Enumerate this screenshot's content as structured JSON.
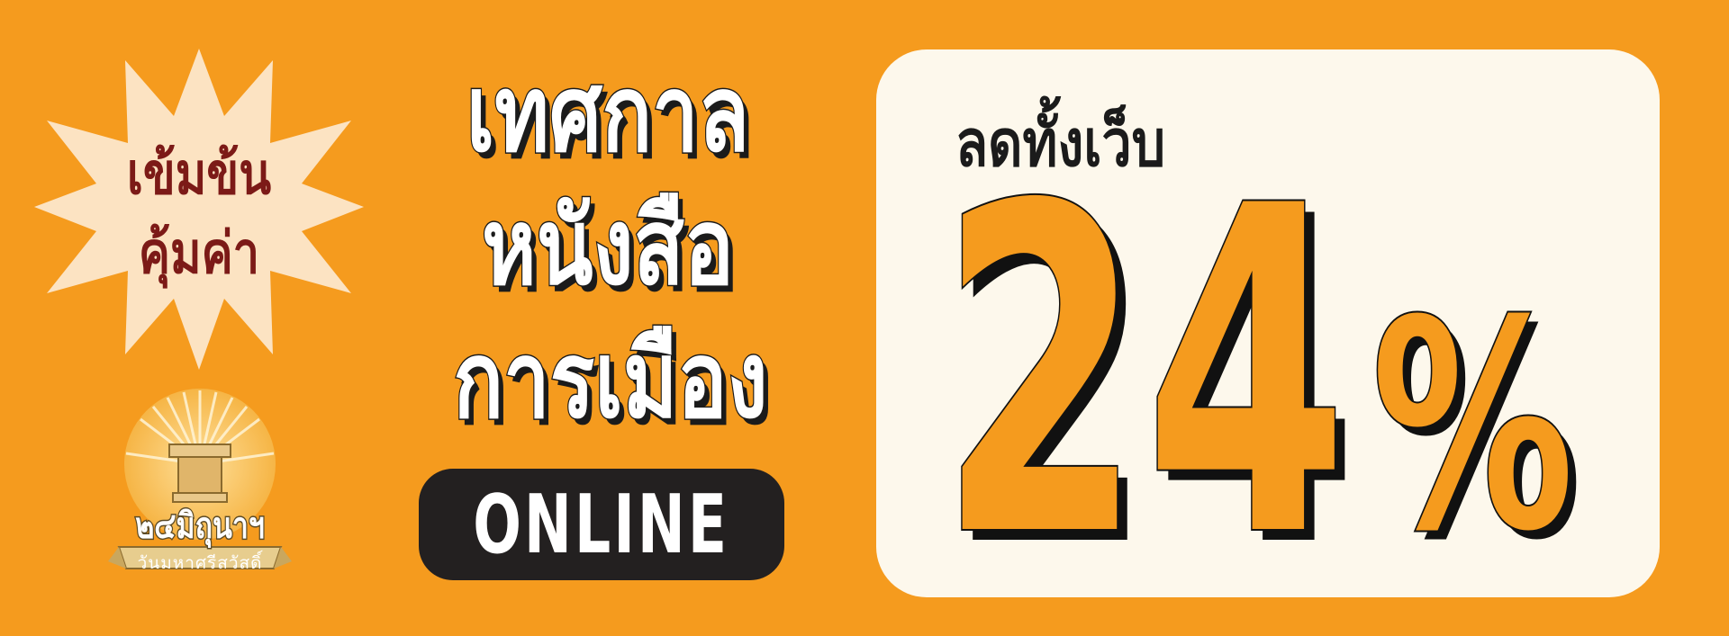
{
  "badge": {
    "line1": "เข้มข้น",
    "line2": "คุ้มค่า"
  },
  "logo": {
    "name": "๒๔มิถุนาฯ",
    "tagline": "วันมหาศรีสวัสดิ์"
  },
  "headline": {
    "line1": "เทศกาล",
    "line2": "หนังสือ",
    "line3": "การเมือง"
  },
  "online_label": "ONLINE",
  "discount": {
    "label": "ลดทั้งเว็บ",
    "value": "24",
    "unit": "%"
  },
  "colors": {
    "background": "#F59B1E",
    "panel": "#FDF8EC",
    "badge_bg": "#FCE3C2",
    "badge_text": "#7C1A17",
    "dark": "#232020"
  }
}
